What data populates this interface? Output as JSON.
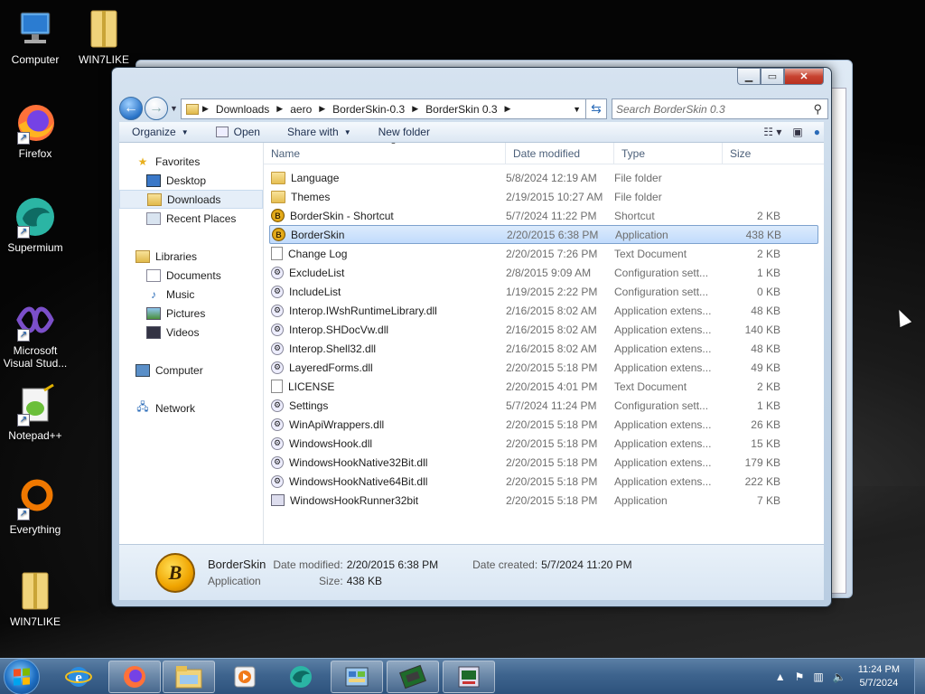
{
  "desktop": {
    "icons": [
      {
        "label": "Computer",
        "icon": "computer-icon"
      },
      {
        "label": "WIN7LIKE",
        "icon": "zip-folder-icon"
      },
      {
        "label": "Firefox",
        "icon": "firefox-icon"
      },
      {
        "label": "Supermium",
        "icon": "supermium-icon"
      },
      {
        "label": "Microsoft\nVisual Stud...",
        "icon": "visual-studio-icon"
      },
      {
        "label": "Notepad++",
        "icon": "notepadpp-icon"
      },
      {
        "label": "Everything",
        "icon": "everything-icon"
      },
      {
        "label": "WIN7LIKE",
        "icon": "zip-folder-icon"
      }
    ]
  },
  "explorer": {
    "breadcrumb": [
      "Downloads",
      "aero",
      "BorderSkin-0.3",
      "BorderSkin 0.3"
    ],
    "search_placeholder": "Search BorderSkin 0.3",
    "toolbar": {
      "organize": "Organize",
      "open": "Open",
      "share": "Share with",
      "new_folder": "New folder"
    },
    "nav": {
      "favorites": "Favorites",
      "desktop": "Desktop",
      "downloads": "Downloads",
      "recent": "Recent Places",
      "libraries": "Libraries",
      "documents": "Documents",
      "music": "Music",
      "pictures": "Pictures",
      "videos": "Videos",
      "computer": "Computer",
      "network": "Network"
    },
    "columns": {
      "name": "Name",
      "date": "Date modified",
      "type": "Type",
      "size": "Size"
    },
    "files": [
      {
        "name": "Language",
        "date": "5/8/2024 12:19 AM",
        "type": "File folder",
        "size": "",
        "icon": "folder"
      },
      {
        "name": "Themes",
        "date": "2/19/2015 10:27 AM",
        "type": "File folder",
        "size": "",
        "icon": "folder"
      },
      {
        "name": "BorderSkin - Shortcut",
        "date": "5/7/2024 11:22 PM",
        "type": "Shortcut",
        "size": "2 KB",
        "icon": "bs"
      },
      {
        "name": "BorderSkin",
        "date": "2/20/2015 6:38 PM",
        "type": "Application",
        "size": "438 KB",
        "icon": "bs"
      },
      {
        "name": "Change Log",
        "date": "2/20/2015 7:26 PM",
        "type": "Text Document",
        "size": "2 KB",
        "icon": "doc"
      },
      {
        "name": "ExcludeList",
        "date": "2/8/2015 9:09 AM",
        "type": "Configuration sett...",
        "size": "1 KB",
        "icon": "gear"
      },
      {
        "name": "IncludeList",
        "date": "1/19/2015 2:22 PM",
        "type": "Configuration sett...",
        "size": "0 KB",
        "icon": "gear"
      },
      {
        "name": "Interop.IWshRuntimeLibrary.dll",
        "date": "2/16/2015 8:02 AM",
        "type": "Application extens...",
        "size": "48 KB",
        "icon": "gear"
      },
      {
        "name": "Interop.SHDocVw.dll",
        "date": "2/16/2015 8:02 AM",
        "type": "Application extens...",
        "size": "140 KB",
        "icon": "gear"
      },
      {
        "name": "Interop.Shell32.dll",
        "date": "2/16/2015 8:02 AM",
        "type": "Application extens...",
        "size": "48 KB",
        "icon": "gear"
      },
      {
        "name": "LayeredForms.dll",
        "date": "2/20/2015 5:18 PM",
        "type": "Application extens...",
        "size": "49 KB",
        "icon": "gear"
      },
      {
        "name": "LICENSE",
        "date": "2/20/2015 4:01 PM",
        "type": "Text Document",
        "size": "2 KB",
        "icon": "doc"
      },
      {
        "name": "Settings",
        "date": "5/7/2024 11:24 PM",
        "type": "Configuration sett...",
        "size": "1 KB",
        "icon": "gear"
      },
      {
        "name": "WinApiWrappers.dll",
        "date": "2/20/2015 5:18 PM",
        "type": "Application extens...",
        "size": "26 KB",
        "icon": "gear"
      },
      {
        "name": "WindowsHook.dll",
        "date": "2/20/2015 5:18 PM",
        "type": "Application extens...",
        "size": "15 KB",
        "icon": "gear"
      },
      {
        "name": "WindowsHookNative32Bit.dll",
        "date": "2/20/2015 5:18 PM",
        "type": "Application extens...",
        "size": "179 KB",
        "icon": "gear"
      },
      {
        "name": "WindowsHookNative64Bit.dll",
        "date": "2/20/2015 5:18 PM",
        "type": "Application extens...",
        "size": "222 KB",
        "icon": "gear"
      },
      {
        "name": "WindowsHookRunner32bit",
        "date": "2/20/2015 5:18 PM",
        "type": "Application",
        "size": "7 KB",
        "icon": "app"
      }
    ],
    "selected_index": 3,
    "details": {
      "name": "BorderSkin",
      "type": "Application",
      "modified_label": "Date modified:",
      "modified": "2/20/2015 6:38 PM",
      "size_label": "Size:",
      "size": "438 KB",
      "created_label": "Date created:",
      "created": "5/7/2024 11:20 PM"
    }
  },
  "taskbar": {
    "time": "11:24 PM",
    "date": "5/7/2024",
    "pinned": [
      "ie-icon",
      "firefox-icon",
      "explorer-icon",
      "media-player-icon",
      "supermium-icon",
      "control-panel-icon",
      "gpu-monitor-icon",
      "task-manager-icon"
    ]
  }
}
